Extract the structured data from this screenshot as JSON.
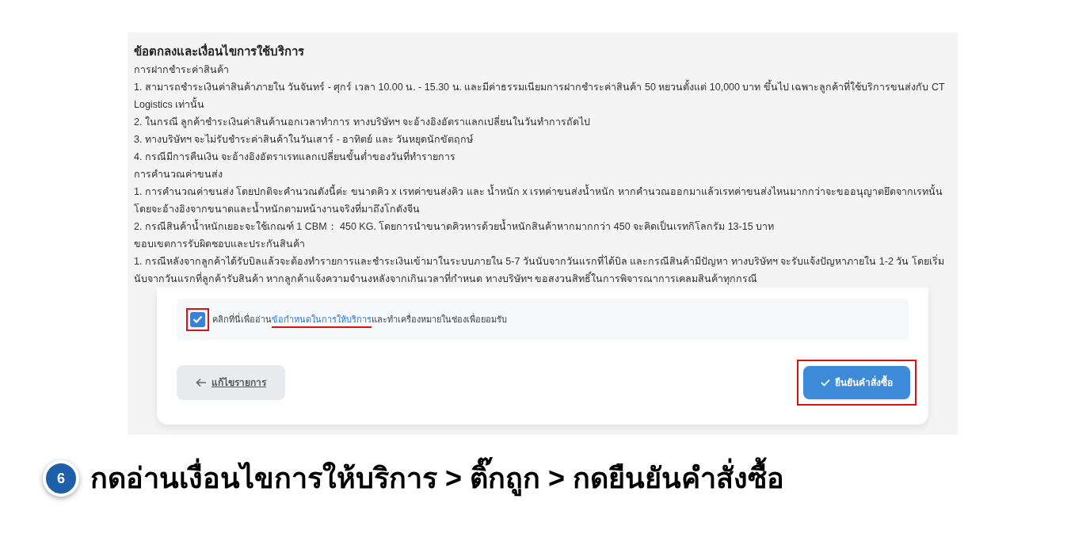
{
  "terms": {
    "title": "ข้อตกลงและเงื่อนไขการใช้บริการ",
    "sections": [
      {
        "heading": "การฝากชำระค่าสินค้า",
        "items": [
          "1. สามารถชำระเงินค่าสินค้าภายใน วันจันทร์ - ศุกร์ เวลา 10.00 น. - 15.30 น. และมีค่าธรรมเนียมการฝากชำระค่าสินค้า 50 หยวนตั้งแต่ 10,000 บาท ขึ้นไป เฉพาะลูกค้าที่ใช้บริการขนส่งกับ CT Logistics เท่านั้น",
          "2. ในกรณี ลูกค้าชำระเงินค่าสินค้านอกเวลาทำการ ทางบริษัทฯ จะอ้างอิงอัตราแลกเปลี่ยนในวันทำการถัดไป",
          "3. ทางบริษัทฯ จะไม่รับชำระค่าสินค้าในวันเสาร์ - อาทิตย์ และ วันหยุดนักขัตฤกษ์",
          "4. กรณีมีการคืนเงิน จะอ้างอิงอัตราเรทแลกเปลี่ยนขั้นต่ำของวันที่ทำรายการ"
        ]
      },
      {
        "heading": "การคำนวณค่าขนส่ง",
        "items": [
          "1. การคำนวณค่าขนส่ง โดยปกติจะคำนวณดังนี้ค่ะ ขนาดคิว x เรทค่าขนส่งคิว และ น้ำหนัก x เรทค่าขนส่งน้ำหนัก หากคำนวณออกมาแล้วเรทค่าขนส่งไหนมากกว่าจะขออนุญาตยึดจากเรทนั้น โดยจะอ้างอิงจากขนาดและน้ำหนักตามหน้างานจริงที่มาถึงโกดังจีน",
          "2. กรณีสินค้าน้ำหนักเยอะจะใช้เกณฑ์ 1 CBM： 450 KG. โดยการนำขนาดคิวหารด้วยน้ำหนักสินค้าหากมากกว่า 450 จะคิดเป็นเรทกิโลกรัม 13-15 บาท"
        ]
      },
      {
        "heading": "ขอบเขตการรับผิดชอบและประกันสินค้า",
        "items": [
          "1. กรณีหลังจากลูกค้าได้รับบิลแล้วจะต้องทำรายการและชำระเงินเข้ามาในระบบภายใน 5-7 วันนับจากวันแรกที่ได้บิล และกรณีสินค้ามีปัญหา ทางบริษัทฯ จะรับแจ้งปัญหาภายใน 1-2 วัน โดยเริ่มนับจากวันแรกที่ลูกค้ารับสินค้า หากลูกค้าแจ้งความจำนงหลังจากเกินเวลาที่กำหนด ทางบริษัทฯ ขอสงวนสิทธิ์ในการพิจารณาการเคลมสินค้าทุกกรณี"
        ]
      }
    ]
  },
  "agreement": {
    "checked": true,
    "highlighted": true,
    "text_before": "คลิกที่นี่เพื่ออ่าน",
    "link": "ข้อกำหนดในการให้บริการ",
    "link_highlighted": true,
    "text_after": "และทำเครื่องหมายในช่องเพื่อยอมรับ"
  },
  "back_button": {
    "label": "แก้ไขรายการ"
  },
  "confirm_button": {
    "label": "ยืนยันคำสั่งซื้อ",
    "highlighted": true
  },
  "caption": {
    "step": "6",
    "text": "กดอ่านเงื่อนไขการให้บริการ > ติ๊กถูก > กดยืนยันคำสั่งซื้อ"
  }
}
